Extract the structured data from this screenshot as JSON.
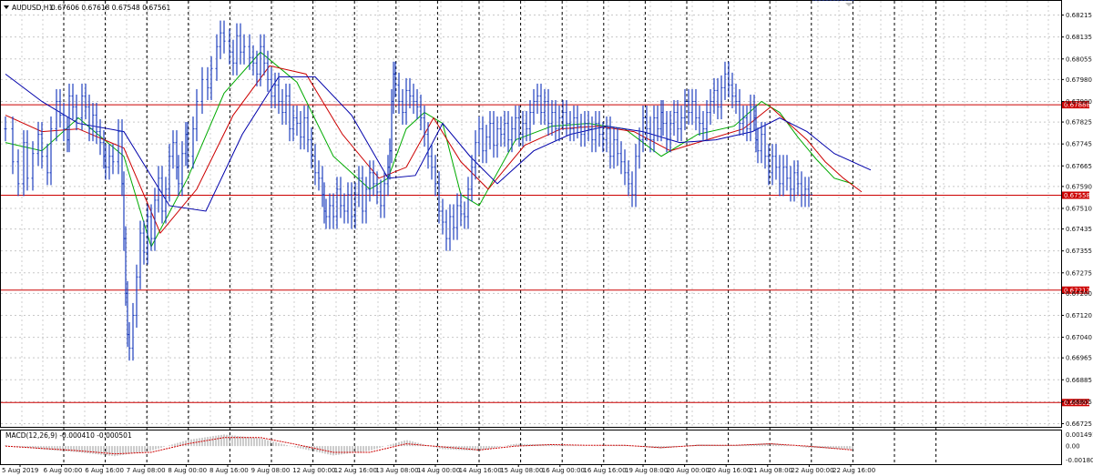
{
  "header": {
    "symbol": "AUDUSD,H1",
    "ohlc": "0.67606 0.67618 0.67548 0.67561",
    "macd_label": "MACD(12,26,9) -0.000410 -0.000501"
  },
  "chart_data": {
    "type": "line",
    "title": "AUDUSD,H1",
    "price_axis": {
      "ylim": [
        0.6672,
        0.6826
      ],
      "ticks": [
        "0.68215",
        "0.68135",
        "0.68055",
        "0.67980",
        "0.67900",
        "0.67825",
        "0.67745",
        "0.67665",
        "0.67590",
        "0.67510",
        "0.67435",
        "0.67355",
        "0.67275",
        "0.67200",
        "0.67120",
        "0.67040",
        "0.66965",
        "0.66885",
        "0.66805",
        "0.66725"
      ]
    },
    "macd_axis": {
      "ylim": [
        -0.0021,
        0.0019
      ],
      "ticks": [
        "0.001491",
        "0.00",
        "-0.001808"
      ]
    },
    "x_ticks": [
      "5 Aug 2019",
      "6 Aug 00:00",
      "6 Aug 16:00",
      "7 Aug 08:00",
      "8 Aug 00:00",
      "8 Aug 16:00",
      "9 Aug 08:00",
      "12 Aug 00:00",
      "12 Aug 16:00",
      "13 Aug 08:00",
      "14 Aug 00:00",
      "14 Aug 16:00",
      "15 Aug 08:00",
      "16 Aug 00:00",
      "16 Aug 16:00",
      "19 Aug 08:00",
      "20 Aug 00:00",
      "20 Aug 16:00",
      "21 Aug 08:00",
      "22 Aug 00:00",
      "22 Aug 16:00"
    ],
    "horizontal_levels": [
      {
        "value": 0.67888,
        "label": "0.67888"
      },
      {
        "value": 0.67558,
        "label": "0.67558"
      },
      {
        "value": 0.67212,
        "label": "0.67212"
      },
      {
        "value": 0.66802,
        "label": "0.66802"
      }
    ],
    "price_series": {
      "name": "Close (approx.)",
      "x": [
        0,
        8,
        14,
        20,
        24,
        30,
        36,
        40,
        46,
        50,
        56,
        60,
        64,
        68,
        70,
        74,
        78,
        84,
        88,
        92,
        96,
        100,
        104,
        108,
        110,
        114,
        118,
        124,
        128,
        130,
        132,
        134,
        136,
        140,
        144,
        148,
        152,
        156,
        160,
        164,
        168,
        172,
        176,
        180,
        184,
        188,
        190,
        194,
        198,
        200,
        206,
        210,
        216,
        222,
        226,
        232,
        236,
        240,
        246,
        250,
        254,
        258,
        262,
        268,
        272,
        276,
        280,
        284,
        288,
        292,
        296,
        300,
        304,
        308,
        312,
        316,
        320,
        324,
        328,
        332,
        336,
        340,
        344,
        348,
        350,
        352,
        356,
        360,
        364,
        368,
        372,
        376,
        380,
        384,
        388,
        392,
        396,
        400,
        404,
        408,
        412,
        416,
        420,
        422,
        424,
        426,
        428,
        432,
        436,
        440,
        444,
        448,
        452,
        456,
        460,
        464,
        468,
        472,
        476,
        480,
        484,
        488,
        492,
        496,
        500,
        504,
        508,
        512,
        516,
        520,
        524,
        528,
        532,
        536,
        540,
        544,
        548,
        552,
        556,
        560,
        564,
        568,
        572,
        576,
        580,
        584,
        588,
        592,
        596,
        600,
        604,
        608,
        612,
        616,
        620,
        624,
        628,
        632,
        636,
        640,
        644,
        648,
        652,
        656,
        660,
        664,
        668,
        672,
        676,
        680,
        684,
        688,
        692,
        696,
        700,
        704,
        708,
        712,
        716,
        720,
        722,
        726,
        730,
        734,
        738,
        742,
        746,
        750,
        754,
        758,
        762,
        766,
        770,
        774,
        778,
        782,
        786,
        790,
        794,
        798,
        802,
        806,
        810,
        814,
        818,
        822,
        824,
        826,
        830,
        834,
        838,
        842,
        846,
        850,
        854,
        858,
        862,
        866,
        870,
        874,
        878,
        882,
        886,
        890,
        894,
        898,
        902,
        906,
        910,
        914,
        918,
        922,
        926,
        930
      ],
      "values": [
        0.678,
        0.6768,
        0.676,
        0.6775,
        0.6762,
        0.6771,
        0.6778,
        0.677,
        0.6764,
        0.678,
        0.679,
        0.6785,
        0.678,
        0.6776,
        0.6792,
        0.6788,
        0.6784,
        0.6792,
        0.6788,
        0.678,
        0.6785,
        0.6779,
        0.6775,
        0.677,
        0.6766,
        0.677,
        0.6768,
        0.6779,
        0.676,
        0.674,
        0.672,
        0.6705,
        0.67,
        0.6712,
        0.6726,
        0.6742,
        0.6735,
        0.6748,
        0.674,
        0.6754,
        0.6762,
        0.675,
        0.6758,
        0.677,
        0.6775,
        0.6766,
        0.676,
        0.6771,
        0.6778,
        0.677,
        0.678,
        0.679,
        0.6798,
        0.6795,
        0.6802,
        0.681,
        0.6815,
        0.6812,
        0.6808,
        0.6804,
        0.6814,
        0.6808,
        0.681,
        0.6806,
        0.6804,
        0.68,
        0.681,
        0.6804,
        0.6798,
        0.6792,
        0.6796,
        0.679,
        0.6786,
        0.6792,
        0.678,
        0.6784,
        0.6782,
        0.6777,
        0.6784,
        0.6776,
        0.677,
        0.6764,
        0.6762,
        0.6756,
        0.675,
        0.6748,
        0.6752,
        0.6748,
        0.6758,
        0.6752,
        0.675,
        0.6756,
        0.6748,
        0.6756,
        0.6762,
        0.675,
        0.6758,
        0.6764,
        0.676,
        0.6757,
        0.6752,
        0.676,
        0.6766,
        0.6772,
        0.679,
        0.68,
        0.6796,
        0.679,
        0.6786,
        0.6794,
        0.6792,
        0.679,
        0.6788,
        0.6784,
        0.6778,
        0.677,
        0.6766,
        0.676,
        0.675,
        0.6746,
        0.674,
        0.6748,
        0.6744,
        0.6752,
        0.6749,
        0.6748,
        0.6758,
        0.6766,
        0.6775,
        0.678,
        0.6772,
        0.6777,
        0.6782,
        0.6774,
        0.678,
        0.6778,
        0.6782,
        0.6776,
        0.678,
        0.6784,
        0.6778,
        0.6782,
        0.678,
        0.6786,
        0.679,
        0.6792,
        0.6786,
        0.679,
        0.6782,
        0.6786,
        0.678,
        0.6784,
        0.6786,
        0.6782,
        0.678,
        0.6784,
        0.6781,
        0.6778,
        0.6782,
        0.678,
        0.6776,
        0.6782,
        0.6778,
        0.6776,
        0.678,
        0.677,
        0.6776,
        0.6771,
        0.6768,
        0.6764,
        0.676,
        0.6756,
        0.677,
        0.6776,
        0.6784,
        0.678,
        0.6776,
        0.6784,
        0.678,
        0.6786,
        0.6782,
        0.6776,
        0.6782,
        0.6786,
        0.678,
        0.6784,
        0.679,
        0.6786,
        0.679,
        0.6784,
        0.6782,
        0.678,
        0.6786,
        0.679,
        0.6794,
        0.6788,
        0.6795,
        0.68,
        0.6796,
        0.6792,
        0.679,
        0.6782,
        0.6784,
        0.678,
        0.6788,
        0.6784,
        0.6776,
        0.6772,
        0.6778,
        0.677,
        0.6764,
        0.677,
        0.6766,
        0.676,
        0.6766,
        0.6762,
        0.6758,
        0.6764,
        0.676,
        0.6756,
        0.6758,
        0.6756
      ]
    },
    "moving_averages": [
      {
        "color": "#00aa00",
        "values_at": [
          0,
          40,
          80,
          130,
          160,
          200,
          240,
          280,
          320,
          360,
          400,
          420,
          440,
          460,
          480,
          500,
          520,
          560,
          600,
          640,
          680,
          720,
          760,
          800,
          830,
          850,
          870,
          890,
          910,
          930
        ],
        "values": [
          0.6775,
          0.6772,
          0.6784,
          0.677,
          0.6737,
          0.6762,
          0.6793,
          0.6808,
          0.6797,
          0.677,
          0.6758,
          0.6762,
          0.678,
          0.6786,
          0.6782,
          0.6756,
          0.6752,
          0.6776,
          0.6781,
          0.6782,
          0.678,
          0.677,
          0.6778,
          0.6781,
          0.679,
          0.6786,
          0.6777,
          0.6769,
          0.6762,
          0.676
        ]
      },
      {
        "color": "#cc0000",
        "values_at": [
          0,
          40,
          80,
          130,
          170,
          210,
          250,
          290,
          330,
          370,
          410,
          440,
          470,
          500,
          530,
          570,
          610,
          650,
          690,
          730,
          770,
          810,
          840,
          860,
          880,
          900,
          920,
          940
        ],
        "values": [
          0.6785,
          0.6779,
          0.678,
          0.6773,
          0.6742,
          0.6758,
          0.6785,
          0.6803,
          0.68,
          0.6778,
          0.6762,
          0.6766,
          0.6784,
          0.6768,
          0.6758,
          0.6774,
          0.678,
          0.6781,
          0.6779,
          0.6772,
          0.6776,
          0.678,
          0.6788,
          0.6782,
          0.6776,
          0.6768,
          0.6762,
          0.6757
        ]
      },
      {
        "color": "#0000aa",
        "values_at": [
          0,
          40,
          80,
          130,
          180,
          220,
          260,
          300,
          340,
          380,
          420,
          450,
          480,
          510,
          540,
          580,
          620,
          660,
          700,
          740,
          780,
          820,
          850,
          880,
          910,
          950
        ],
        "values": [
          0.68,
          0.679,
          0.6782,
          0.6779,
          0.6752,
          0.675,
          0.6778,
          0.6799,
          0.6799,
          0.6785,
          0.6762,
          0.6763,
          0.6782,
          0.677,
          0.676,
          0.6772,
          0.6778,
          0.6781,
          0.6779,
          0.6775,
          0.6776,
          0.6779,
          0.6784,
          0.6779,
          0.6771,
          0.6765
        ]
      }
    ],
    "macd_series": {
      "name": "MACD(12,26,9)",
      "x": [
        0,
        40,
        80,
        120,
        160,
        200,
        240,
        280,
        320,
        360,
        400,
        440,
        480,
        520,
        560,
        600,
        640,
        680,
        720,
        760,
        800,
        840,
        880,
        930
      ],
      "values": [
        0.0001,
        -0.0004,
        -0.0008,
        -0.0013,
        -0.0006,
        0.0008,
        0.0015,
        0.001,
        -0.0002,
        -0.0012,
        -0.0006,
        0.0008,
        -0.0004,
        -0.0006,
        0.0003,
        0.0002,
        0.0,
        0.0001,
        -0.0003,
        0.0002,
        0.0001,
        0.0004,
        -0.0002,
        -0.0004
      ],
      "signal": [
        0.0,
        -0.0003,
        -0.0006,
        -0.001,
        -0.0008,
        0.0003,
        0.0011,
        0.0011,
        0.0002,
        -0.0008,
        -0.0008,
        0.0003,
        -0.0001,
        -0.0005,
        0.0,
        0.0002,
        0.0001,
        0.0001,
        -0.0002,
        0.0001,
        0.0001,
        0.0003,
        0.0,
        -0.0005
      ]
    },
    "grid": true,
    "colors": {
      "bars": "#1f3fbf",
      "levels": "#cc0000",
      "macd_hist": "#999999",
      "macd_signal": "#cc0000"
    }
  }
}
